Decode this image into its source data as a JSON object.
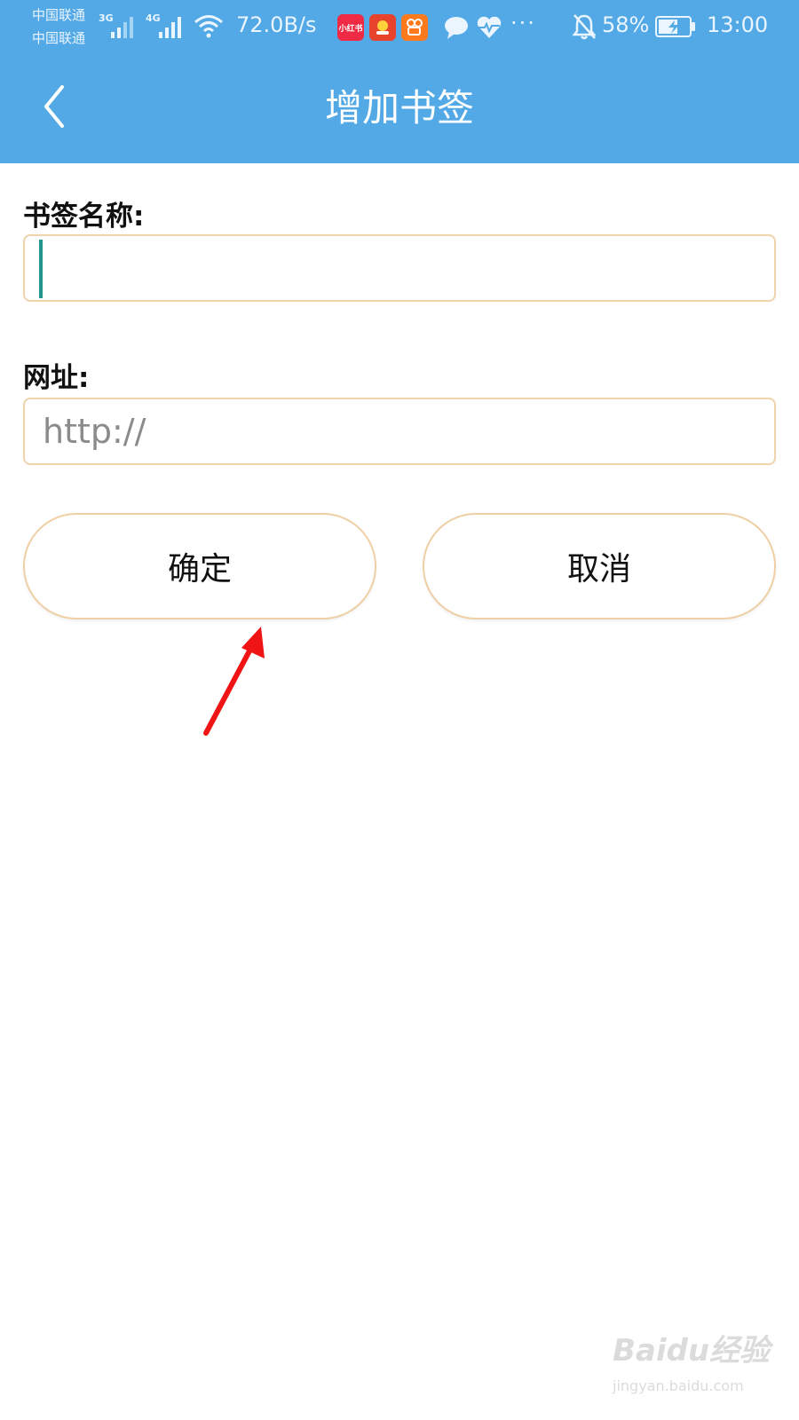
{
  "status_bar": {
    "carrier_1": "中国联通",
    "carrier_2": "中国联通",
    "network_1": "3G",
    "network_2": "4G",
    "net_speed": "72.0B/s",
    "notification_icons": [
      "xiaohongshu-app-icon",
      "game-app-icon",
      "kuaishou-app-icon",
      "message-icon",
      "health-icon"
    ],
    "xiaohongshu_label": "小红书",
    "more": "···",
    "battery_percent": "58%",
    "time": "13:00",
    "colors": {
      "text": "#eaf5ff"
    }
  },
  "header": {
    "title": "增加书签",
    "back_icon": "chevron-left-icon",
    "background_color": "#53a9e6"
  },
  "form": {
    "name_label": "书签名称:",
    "name_value": "",
    "url_label": "网址:",
    "url_placeholder": "http://",
    "field_border_color": "#efd3ad",
    "caret_color": "#22968a"
  },
  "actions": {
    "confirm_label": "确定",
    "cancel_label": "取消"
  },
  "annotation": {
    "arrow_icon": "red-arrow-icon",
    "arrow_color": "#f01414"
  },
  "watermark": {
    "brand": "Baidu经验",
    "url": "jingyan.baidu.com"
  }
}
